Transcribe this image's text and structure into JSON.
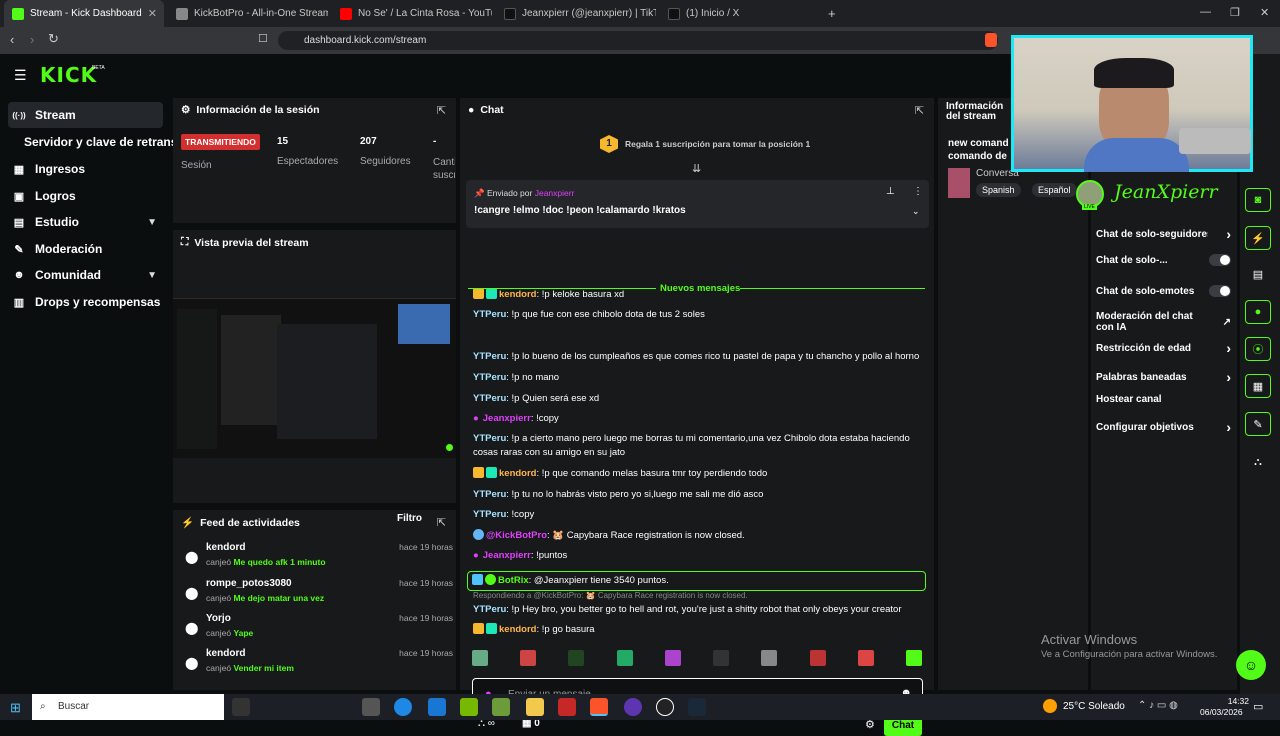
{
  "browser": {
    "tabs": [
      {
        "label": "Stream - Kick Dashboard",
        "color": "#53fc18"
      },
      {
        "label": "KickBotPro - All-in-One Streaming To",
        "color": "#bbb"
      },
      {
        "label": "No Se' / La Cinta Rosa - YouTube",
        "color": "#ff0000"
      },
      {
        "label": "Jeanxpierr (@jeanxpierr) | TikTok",
        "color": "#222"
      },
      {
        "label": "(1) Inicio / X",
        "color": "#222"
      }
    ],
    "url": "dashboard.kick.com/stream"
  },
  "sidebar": {
    "logo": "KICK",
    "beta": "BETA",
    "items": [
      {
        "label": "Stream",
        "icon": "((·))"
      },
      {
        "label": "Servidor y clave de retransm",
        "icon": ""
      },
      {
        "label": "Ingresos",
        "icon": "▦"
      },
      {
        "label": "Logros",
        "icon": "▣"
      },
      {
        "label": "Estudio",
        "icon": "▤"
      },
      {
        "label": "Moderación",
        "icon": "🔧"
      },
      {
        "label": "Comunidad",
        "icon": "👥"
      },
      {
        "label": "Drops y recompensas",
        "icon": "▥"
      }
    ]
  },
  "session": {
    "title": "Información de la sesión",
    "status": "TRANSMITIENDO",
    "session_label": "Sesión",
    "stats": [
      {
        "value": "15",
        "label": "Espectadores"
      },
      {
        "value": "207",
        "label": "Seguidores"
      },
      {
        "value": "-",
        "label": "Cantid suscr"
      }
    ]
  },
  "preview": {
    "title": "Vista previa del stream"
  },
  "feed": {
    "title": "Feed de actividades",
    "filter": "Filtro",
    "items": [
      {
        "name": "kendord",
        "action": "canjeó",
        "reward": "Me quedo afk 1 minuto",
        "time": "hace 19 horas"
      },
      {
        "name": "rompe_potos3080",
        "action": "canjeó",
        "reward": "Me dejo matar una vez",
        "time": "hace 19 horas"
      },
      {
        "name": "Yorjo",
        "action": "canjeó",
        "reward": "Yape",
        "time": "hace 19 horas"
      },
      {
        "name": "kendord",
        "action": "canjeó",
        "reward": "Vender mi item",
        "time": "hace 19 horas"
      }
    ]
  },
  "chat": {
    "title": "Chat",
    "gift_rank": "1",
    "gift_text": "Regala 1 suscripción para tomar la posición 1",
    "pinned_by": "Enviado por",
    "pinned_user": "Jeanxpierr",
    "pinned_text": "!cangre !elmo !doc !peon !calamardo !kratos",
    "new_messages": "Nuevos mensajes",
    "messages": [
      {
        "user": "kendord",
        "text": ": !p keloke basura xd",
        "cls": "u-o",
        "badge": true
      },
      {
        "user": "YTPeru",
        "text": ": !p que fue con ese chibolo dota de tus 2 soles",
        "cls": "u-yt"
      },
      {
        "user": "YTPeru",
        "text": ": !p lo bueno de los cumpleaños es que comes rico tu pastel de papa y tu chancho y pollo al horno",
        "cls": "u-yt"
      },
      {
        "user": "YTPeru",
        "text": ": !p no mano",
        "cls": "u-yt"
      },
      {
        "user": "YTPeru",
        "text": ": !p Quien será ese xd",
        "cls": "u-yt"
      },
      {
        "user": "Jeanxpierr",
        "text": ": !copy",
        "cls": "u-p",
        "mic": true
      },
      {
        "user": "YTPeru",
        "text": ": !p a cierto mano pero luego me borras tu mi comentario,una vez Chibolo dota estaba haciendo cosas raras con su amigo en su jato",
        "cls": "u-yt"
      },
      {
        "user": "kendord",
        "text": ": !p que comando melas basura tmr toy perdiendo todo",
        "cls": "u-o",
        "badge": true
      },
      {
        "user": "YTPeru",
        "text": ": !p tu no lo habrás visto pero yo si,luego me sali me dió asco",
        "cls": "u-yt"
      },
      {
        "user": "YTPeru",
        "text": ": !copy",
        "cls": "u-yt"
      },
      {
        "user": "@KickBotPro",
        "text": ": 🐹 Capybara Race registration is now closed.",
        "cls": "u-p",
        "bot": true
      },
      {
        "user": "Jeanxpierr",
        "text": ": !puntos",
        "cls": "u-p",
        "mic": true
      },
      {
        "user": "BotRix",
        "text": ": @Jeanxpierr tiene 3540 puntos.",
        "cls": "u-g",
        "highlight": true
      },
      {
        "reply": "Respondiendo a @KickBotPro: 🐹 Capybara Race registration is now closed."
      },
      {
        "user": "YTPeru",
        "text": ": !p Hey bro, you better go to hell and rot, you're just a shitty robot that only obeys your creator",
        "cls": "u-yt"
      },
      {
        "user": "kendord",
        "text": ": !p go basura",
        "cls": "u-o",
        "badge": true
      }
    ],
    "placeholder": "Enviar un mensaje",
    "points": "∞",
    "count": "0",
    "send": "Chat"
  },
  "info": {
    "title": "Información del stream",
    "line1": "new comand",
    "line2": "comando de",
    "category": "Conversa",
    "tags": [
      "Spanish",
      "Español"
    ]
  },
  "webcam": {
    "name": "JeanXpierr",
    "live": "LIVE"
  },
  "settings": [
    {
      "label": "Chat de solo-seguidores",
      "type": "chev"
    },
    {
      "label": "Chat de solo-...",
      "type": "toggle"
    },
    {
      "label": "Chat de solo-emotes",
      "type": "toggle"
    },
    {
      "label": "Moderación del chat con IA",
      "type": "ext"
    },
    {
      "label": "Restricción de edad",
      "type": "chev"
    },
    {
      "label": "Palabras baneadas",
      "type": "chev"
    },
    {
      "label": "Hostear canal",
      "type": "none"
    },
    {
      "label": "Configurar objetivos",
      "type": "chev"
    }
  ],
  "watermark": {
    "title": "Activar Windows",
    "sub": "Ve a Configuración para activar Windows."
  },
  "taskbar": {
    "search": "Buscar",
    "weather": "25°C Soleado",
    "time": "14:32",
    "date": "06/03/2026"
  }
}
